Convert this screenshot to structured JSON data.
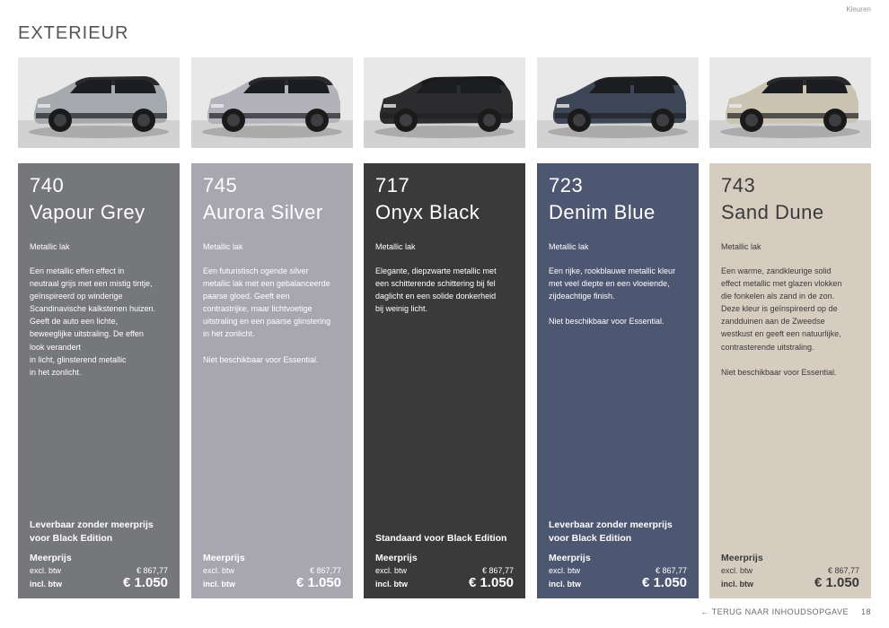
{
  "header": {
    "section": "Kleuren",
    "title": "EXTERIEUR"
  },
  "cards": [
    {
      "code": "740",
      "name": "Vapour Grey",
      "type": "Metallic lak",
      "description": "Een metallic effen effect in\nneutraal grijs met een mistig tintje,\ngeïnspireerd op winderige\nScandinavische kalkstenen huizen.\nGeeft de auto een lichte,\nbeweeglijke uitstraling. De effen\nlook verandert\nin licht, glinsterend metallic\nin het zonlicht.",
      "note": "",
      "standard": "Leverbaar zonder meerprijs\nvoor Black Edition",
      "price_label": "Meerprijs",
      "excl_label": "excl. btw",
      "excl_price": "€ 867,77",
      "incl_label": "incl. btw",
      "incl_price": "€ 1.050",
      "bg": "#76777b",
      "body": "#a4a9ae",
      "roof": "#2a2a2c",
      "sky": "#e8e8e8"
    },
    {
      "code": "745",
      "name": "Aurora Silver",
      "type": "Metallic lak",
      "description": "Een futuristisch ogende silver\nmetallic lak met een gebalanceerde\npaarse gloed. Geeft een\ncontrastrijke, maar lichtvoetige\nuitstraling en een paarse glinstering\nin het zonlicht.",
      "note": "Niet beschikbaar voor Essential.",
      "standard": "",
      "price_label": "Meerprijs",
      "excl_label": "excl. btw",
      "excl_price": "€ 867,77",
      "incl_label": "incl. btw",
      "incl_price": "€ 1.050",
      "bg": "#a8a6ae",
      "body": "#b3b2bb",
      "roof": "#2a2a2c",
      "sky": "#e8e8e8"
    },
    {
      "code": "717",
      "name": "Onyx Black",
      "type": "Metallic lak",
      "description": "Elegante, diepzwarte metallic met\neen schitterende schittering bij fel\ndaglicht en een solide donkerheid\nbij weinig licht.",
      "note": "",
      "standard": "Standaard voor Black Edition",
      "price_label": "Meerprijs",
      "excl_label": "excl. btw",
      "excl_price": "€ 867,77",
      "incl_label": "incl. btw",
      "incl_price": "€ 1.050",
      "bg": "#3a3a3b",
      "body": "#2c2c2e",
      "roof": "#1a1a1b",
      "sky": "#e8e8e8"
    },
    {
      "code": "723",
      "name": "Denim Blue",
      "type": "Metallic lak",
      "description": "Een rijke, rookblauwe metallic kleur\nmet veel diepte en een vloeiende,\nzijdeachtige finish.",
      "note": "Niet beschikbaar voor Essential.",
      "standard": "Leverbaar zonder meerprijs\nvoor Black Edition",
      "price_label": "Meerprijs",
      "excl_label": "excl. btw",
      "excl_price": "€ 867,77",
      "incl_label": "incl. btw",
      "incl_price": "€ 1.050",
      "bg": "#4d5772",
      "body": "#3d4656",
      "roof": "#1e1f22",
      "sky": "#e8e8e8"
    },
    {
      "code": "743",
      "name": "Sand Dune",
      "type": "Metallic lak",
      "description": "Een warme, zandkleurige solid\neffect metallic met glazen vlokken\ndie fonkelen als zand in de zon.\nDeze kleur is geïnspireerd op de\nzandduinen aan de Zweedse\nwestkust en geeft een natuurlijke,\ncontrasterende uitstraling.",
      "note": "Niet beschikbaar voor Essential.",
      "standard": "",
      "price_label": "Meerprijs",
      "excl_label": "excl. btw",
      "excl_price": "€ 867,77",
      "incl_label": "incl. btw",
      "incl_price": "€ 1.050",
      "bg": "#d6cdc0",
      "body": "#cbc3b1",
      "roof": "#2a2a2c",
      "sky": "#e8e8e8"
    }
  ],
  "footer": {
    "back_arrow": "←",
    "back_label": "TERUG NAAR INHOUDSOPGAVE",
    "page_number": "18"
  }
}
